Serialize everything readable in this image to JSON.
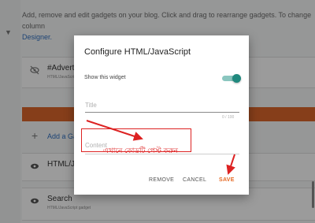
{
  "background": {
    "description_text": "Add, remove and edit gadgets on your blog. Click and drag to rearrange gadgets. To change column",
    "designer_link": "Designer.",
    "widgets": [
      {
        "title": "#Advertis",
        "subtitle": "HTML/JavaScript gadget"
      },
      {
        "title": "HTML/JA",
        "subtitle": ""
      },
      {
        "title": "Search",
        "subtitle": "HTML/JavaScript gadget"
      }
    ],
    "add_gadget_label": "Add a Ga"
  },
  "dialog": {
    "title": "Configure HTML/JavaScript",
    "show_widget_label": "Show this widget",
    "show_widget_on": true,
    "title_placeholder": "Title",
    "title_counter": "0 / 100",
    "content_placeholder": "Content",
    "buttons": {
      "remove": "REMOVE",
      "cancel": "CANCEL",
      "save": "SAVE"
    }
  },
  "annotation": {
    "text": "এখানে কোডটি পেস্ট করুন",
    "color": "#dd2222"
  },
  "colors": {
    "accent_orange": "#d8642a",
    "toggle_teal": "#20897e",
    "save_orange": "#e66a25"
  }
}
